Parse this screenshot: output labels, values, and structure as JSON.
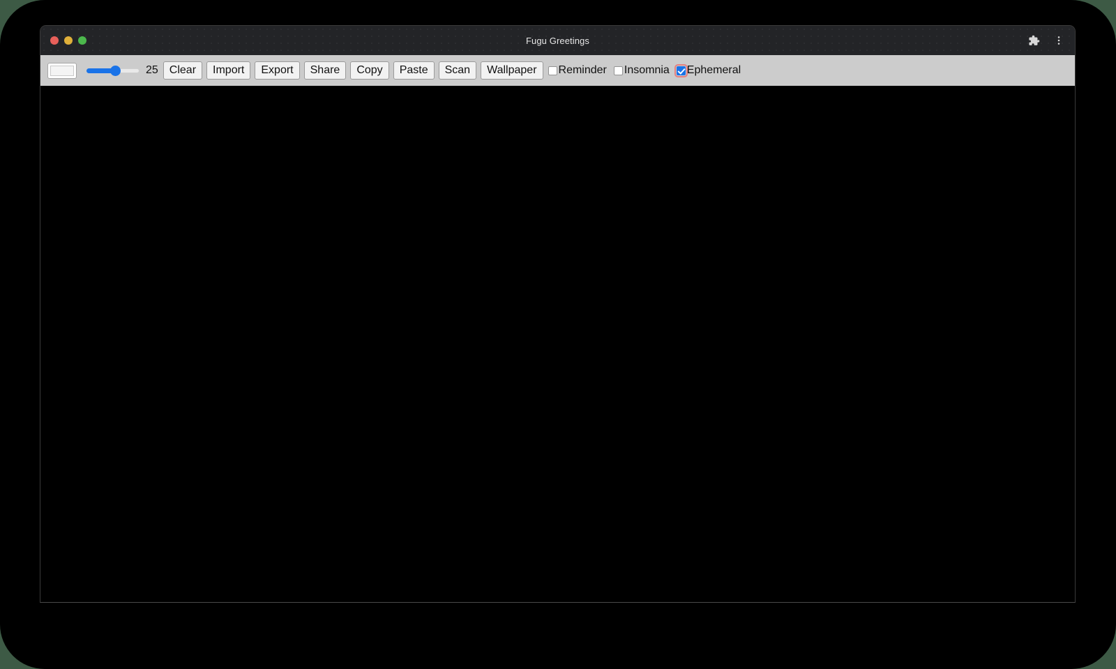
{
  "window": {
    "title": "Fugu Greetings",
    "traffic_lights": [
      {
        "name": "close",
        "color": "#e8605a"
      },
      {
        "name": "minimize",
        "color": "#e0b03a"
      },
      {
        "name": "maximize",
        "color": "#4cb84c"
      }
    ],
    "actions": [
      {
        "icon": "extensions-puzzle-icon"
      },
      {
        "icon": "more-vertical-menu-icon"
      }
    ]
  },
  "toolbar": {
    "color_picker": {
      "value": "#ffffff",
      "label": "color-picker"
    },
    "slider": {
      "value": "25",
      "min": "1",
      "max": "50",
      "percent": 55,
      "fill_color": "#1a73e8"
    },
    "slider_value_label": "25",
    "buttons": [
      {
        "label": "Clear",
        "name": "clear-button"
      },
      {
        "label": "Import",
        "name": "import-button"
      },
      {
        "label": "Export",
        "name": "export-button"
      },
      {
        "label": "Share",
        "name": "share-button"
      },
      {
        "label": "Copy",
        "name": "copy-button"
      },
      {
        "label": "Paste",
        "name": "paste-button"
      },
      {
        "label": "Scan",
        "name": "scan-button"
      },
      {
        "label": "Wallpaper",
        "name": "wallpaper-button"
      }
    ],
    "checkboxes": [
      {
        "label": "Reminder",
        "checked": false,
        "name": "reminder-checkbox"
      },
      {
        "label": "Insomnia",
        "checked": false,
        "name": "insomnia-checkbox"
      },
      {
        "label": "Ephemeral",
        "checked": true,
        "name": "ephemeral-checkbox",
        "focus_ring_color": "#e48080"
      }
    ]
  },
  "canvas": {
    "background_color": "#000000",
    "content": ""
  },
  "colors": {
    "desktop_background": "#3d5a45",
    "frame": "#000000",
    "titlebar": "#232427",
    "toolbar": "#cccccc",
    "accent": "#1a73e8"
  }
}
